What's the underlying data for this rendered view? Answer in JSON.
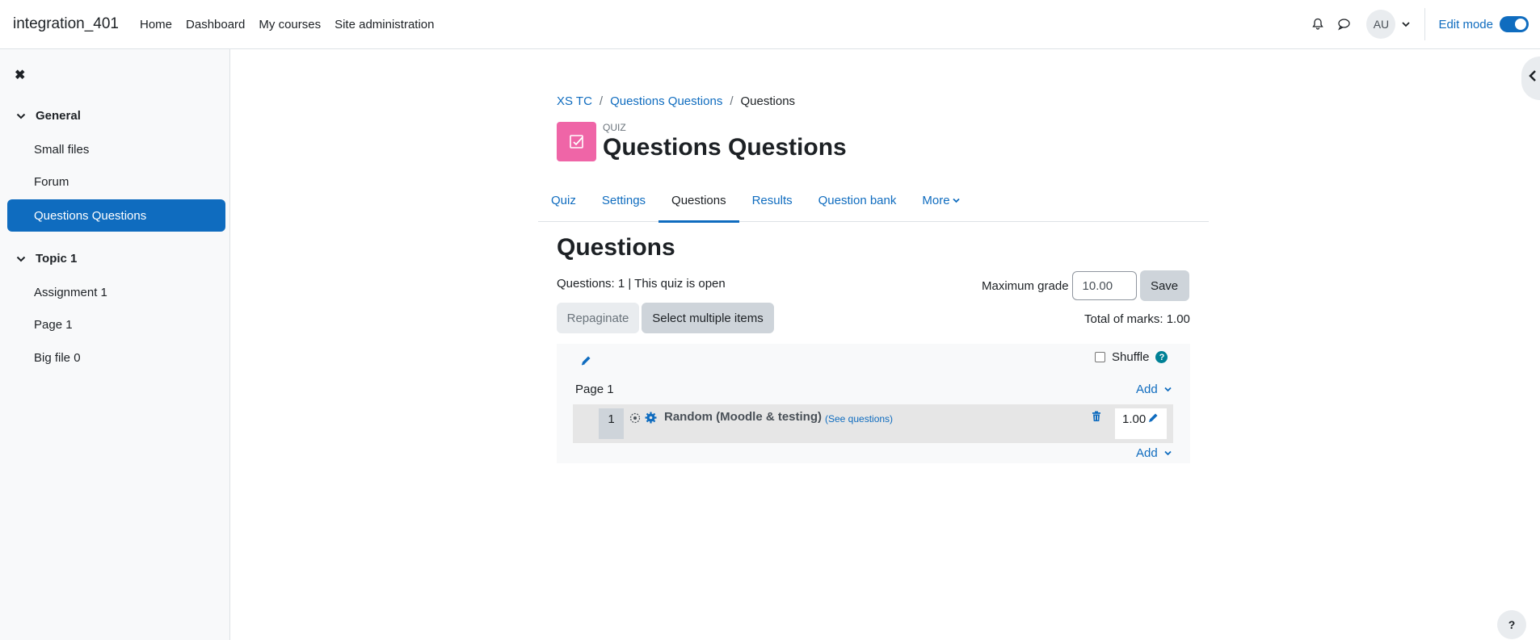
{
  "navbar": {
    "brand": "integration_401",
    "links": [
      "Home",
      "Dashboard",
      "My courses",
      "Site administration"
    ],
    "avatar_initials": "AU",
    "edit_mode_label": "Edit mode",
    "edit_mode_on": true
  },
  "drawer": {
    "sections": [
      {
        "title": "General",
        "items": [
          "Small files",
          "Forum",
          "Questions Questions"
        ]
      },
      {
        "title": "Topic 1",
        "items": [
          "Assignment 1",
          "Page 1",
          "Big file 0"
        ]
      }
    ],
    "active_item": "Questions Questions"
  },
  "breadcrumb": [
    "XS TC",
    "Questions Questions",
    "Questions"
  ],
  "activity": {
    "type_label": "QUIZ",
    "title": "Questions Questions",
    "accent": "#ef65a7"
  },
  "tabs": [
    "Quiz",
    "Settings",
    "Questions",
    "Results",
    "Question bank",
    "More"
  ],
  "active_tab": "Questions",
  "main": {
    "heading": "Questions",
    "status": "Questions: 1 | This quiz is open",
    "max_grade_label": "Maximum grade",
    "max_grade_value": "10.00",
    "save_label": "Save",
    "repaginate_label": "Repaginate",
    "select_multiple_label": "Select multiple items",
    "total_marks": "Total of marks: 1.00"
  },
  "question_panel": {
    "shuffle_label": "Shuffle",
    "page_label": "Page 1",
    "add_label": "Add",
    "question": {
      "number": "1",
      "title": "Random (Moodle & testing)",
      "see_link": "(See questions)",
      "mark": "1.00"
    }
  },
  "help_label": "?",
  "colors": {
    "primary": "#0f6cbf",
    "drawer_bg": "#f8f9fa",
    "help": "#008196"
  }
}
